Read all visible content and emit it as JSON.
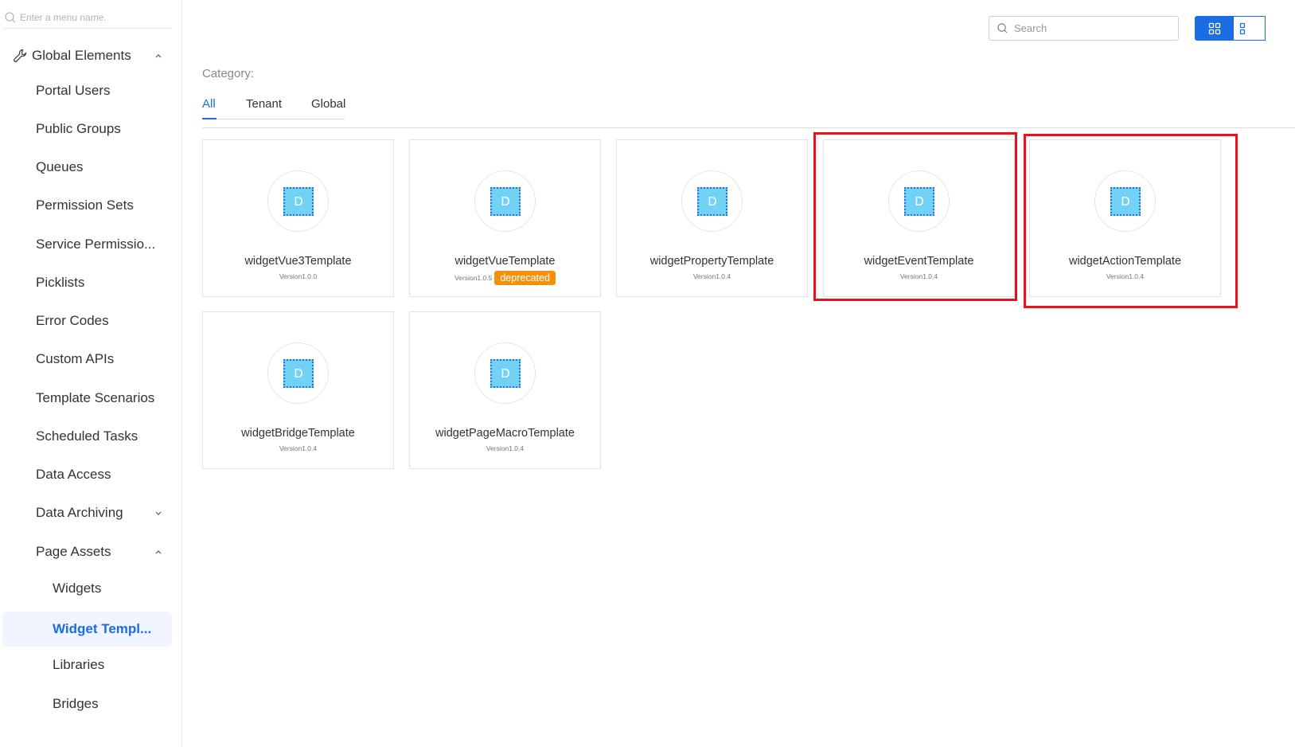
{
  "sidebar": {
    "search_placeholder": "Enter a menu name.",
    "items": [
      {
        "label": "Global Elements",
        "level": 0,
        "icon": "wrench-icon",
        "chevron": "up"
      },
      {
        "label": "Portal Users",
        "level": 1
      },
      {
        "label": "Public Groups",
        "level": 1
      },
      {
        "label": "Queues",
        "level": 1
      },
      {
        "label": "Permission Sets",
        "level": 1
      },
      {
        "label": "Service Permissio...",
        "level": 1
      },
      {
        "label": "Picklists",
        "level": 1
      },
      {
        "label": "Error Codes",
        "level": 1
      },
      {
        "label": "Custom APIs",
        "level": 1
      },
      {
        "label": "Template Scenarios",
        "level": 1
      },
      {
        "label": "Scheduled Tasks",
        "level": 1
      },
      {
        "label": "Data Access",
        "level": 1
      },
      {
        "label": "Data Archiving",
        "level": 1,
        "chevron": "down"
      },
      {
        "label": "Page Assets",
        "level": 1,
        "chevron": "up"
      },
      {
        "label": "Widgets",
        "level": 2
      },
      {
        "label": "Widget Templ...",
        "level": 2,
        "active": true
      },
      {
        "label": "Libraries",
        "level": 2
      },
      {
        "label": "Bridges",
        "level": 2
      }
    ]
  },
  "toolbar": {
    "search_placeholder": "Search",
    "view_modes": [
      "grid",
      "list"
    ],
    "active_view": "grid"
  },
  "category": {
    "label": "Category:",
    "tabs": [
      {
        "label": "All",
        "active": true
      },
      {
        "label": "Tenant"
      },
      {
        "label": "Global"
      }
    ]
  },
  "templates": [
    {
      "name": "widgetVue3Template",
      "version": "Version1.0.0",
      "icon_letter": "D"
    },
    {
      "name": "widgetVueTemplate",
      "version": "Version1.0.5",
      "badge": "deprecated",
      "icon_letter": "D"
    },
    {
      "name": "widgetPropertyTemplate",
      "version": "Version1.0.4",
      "icon_letter": "D"
    },
    {
      "name": "widgetEventTemplate",
      "version": "Version1.0.4",
      "icon_letter": "D",
      "highlighted": true
    },
    {
      "name": "widgetActionTemplate",
      "version": "Version1.0.4",
      "icon_letter": "D",
      "highlighted": true
    },
    {
      "name": "widgetBridgeTemplate",
      "version": "Version1.0.4",
      "icon_letter": "D"
    },
    {
      "name": "widgetPageMacroTemplate",
      "version": "Version1.0.4",
      "icon_letter": "D"
    }
  ],
  "colors": {
    "accent": "#1a6de3",
    "badge": "#f5900c",
    "highlight": "#e8121d",
    "tile": "#72d2f5"
  }
}
